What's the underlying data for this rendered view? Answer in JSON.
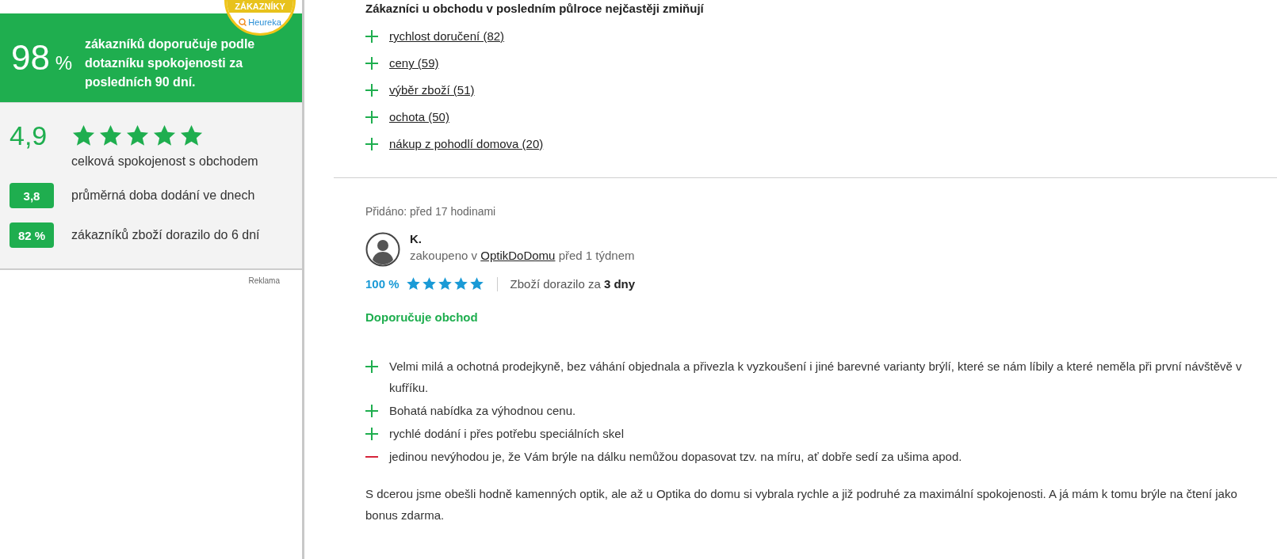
{
  "badge": {
    "band": "ZÁKAZNÍKY",
    "brand": "Heureka"
  },
  "summary": {
    "percent": "98",
    "percent_sign": "%",
    "text": "zákazníků doporučuje podle dotazníku spokojenosti za posledních 90 dní."
  },
  "rating": {
    "score": "4,9",
    "stars": 5,
    "label": "celková spokojenost s obchodem"
  },
  "stats": [
    {
      "value": "3,8",
      "label": "průměrná doba dodání ve dnech"
    },
    {
      "value": "82 %",
      "label": "zákazníků zboží dorazilo do 6 dní"
    }
  ],
  "ad_label": "Reklama",
  "mentions": {
    "heading": "Zákazníci u obchodu v posledním půlroce nejčastěji zmiňují",
    "items": [
      "rychlost doručení (82)",
      "ceny (59)",
      "výběr zboží (51)",
      "ochota (50)",
      "nákup z pohodlí domova (20)"
    ]
  },
  "review": {
    "added": "Přidáno: před 17 hodinami",
    "author": "K.",
    "purchased_prefix": "zakoupeno v",
    "shop_link": "OptikDoDomu",
    "purchased_suffix": "před 1 týdnem",
    "percent": "100 %",
    "stars": 5,
    "delivery": "Zboží dorazilo za **3 dny**",
    "recommends": "Doporučuje obchod",
    "points": [
      {
        "kind": "pro",
        "text": "Velmi milá a ochotná prodejkyně, bez váhání objednala a přivezla k vyzkoušení i jiné barevné varianty brýlí, které se nám líbily a které neměla při první návštěvě v kufříku."
      },
      {
        "kind": "pro",
        "text": "Bohatá nabídka za výhodnou cenu."
      },
      {
        "kind": "pro",
        "text": "rychlé dodání i přes potřebu speciálních skel"
      },
      {
        "kind": "con",
        "text": "jedinou nevýhodou je, že Vám brýle na dálku nemůžou dopasovat tzv. na míru, ať dobře sedí za ušima apod."
      }
    ],
    "body": "S dcerou jsme obešli hodně kamenných optik, ale až u Optika do domu si vybrala rychle a již podruhé za maximální spokojenosti. A já mám k tomu brýle na čtení jako bonus zdarma."
  }
}
